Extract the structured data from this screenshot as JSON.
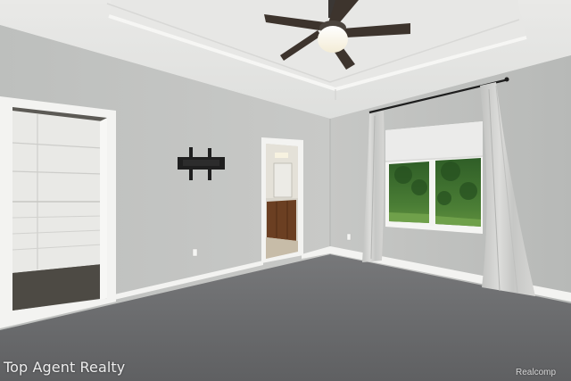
{
  "watermark": {
    "text": "Top Agent Realty"
  },
  "brand": {
    "text": "Realcomp"
  },
  "palette": {
    "wall": "#c4c5c3",
    "ceiling": "#e4e4e2",
    "carpet": "#6e6e6c",
    "trim": "#f2f2f0",
    "curtain": "#d2d2d0",
    "foliage": "#3a6b2c"
  }
}
